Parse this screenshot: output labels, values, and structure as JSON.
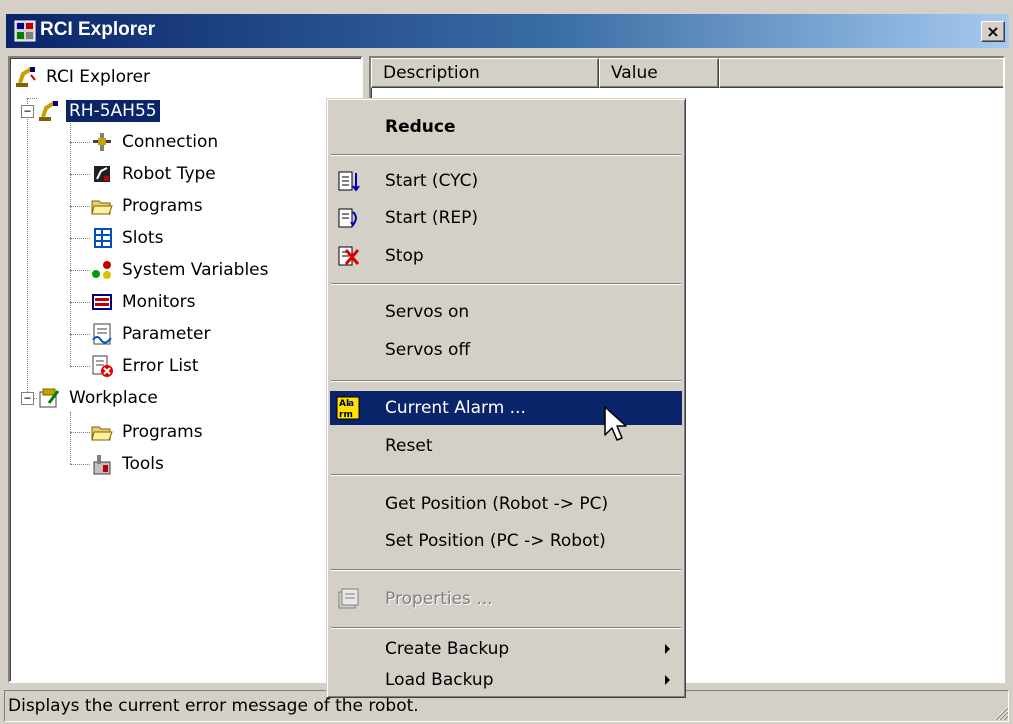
{
  "window": {
    "title": "RCI Explorer",
    "close_label": "×"
  },
  "tree": {
    "root": {
      "label": "RCI Explorer",
      "icon": "robot-arm-icon"
    },
    "robot": {
      "label": "RH-5AH55",
      "expander": "−",
      "icon": "robot-arm-icon"
    },
    "robot_children": [
      {
        "label": "Connection",
        "icon": "connection-icon"
      },
      {
        "label": "Robot Type",
        "icon": "robot-type-icon"
      },
      {
        "label": "Programs",
        "icon": "folder-open-icon"
      },
      {
        "label": "Slots",
        "icon": "slots-icon"
      },
      {
        "label": "System Variables",
        "icon": "system-variables-icon"
      },
      {
        "label": "Monitors",
        "icon": "monitor-icon"
      },
      {
        "label": "Parameter",
        "icon": "parameter-icon"
      },
      {
        "label": "Error List",
        "icon": "error-list-icon"
      }
    ],
    "workplace": {
      "label": "Workplace",
      "expander": "−",
      "icon": "workplace-icon"
    },
    "workplace_children": [
      {
        "label": "Programs",
        "icon": "folder-open-icon"
      },
      {
        "label": "Tools",
        "icon": "tools-icon"
      }
    ]
  },
  "list": {
    "columns": [
      "Description",
      "Value",
      ""
    ]
  },
  "context_menu": {
    "items": [
      {
        "label": "Reduce",
        "bold": true
      },
      {
        "label": "Start (CYC)",
        "icon": "start-cyc-icon"
      },
      {
        "label": "Start (REP)",
        "icon": "start-rep-icon"
      },
      {
        "label": "Stop",
        "icon": "stop-icon"
      },
      {
        "label": "Servos on"
      },
      {
        "label": "Servos off"
      },
      {
        "label": "Current Alarm ...",
        "icon": "alarm-icon",
        "highlighted": true
      },
      {
        "label": "Reset"
      },
      {
        "label": "Get Position (Robot -> PC)"
      },
      {
        "label": "Set Position (PC -> Robot)"
      },
      {
        "label": "Properties ...",
        "icon": "properties-icon",
        "disabled": true
      },
      {
        "label": "Create Backup",
        "submenu": true
      },
      {
        "label": "Load Backup",
        "submenu": true
      }
    ]
  },
  "statusbar": {
    "text": "Displays the current error message of the robot."
  },
  "colors": {
    "title_active": "#0a246a",
    "face": "#d4d0c8",
    "highlight": "#0a246a"
  }
}
